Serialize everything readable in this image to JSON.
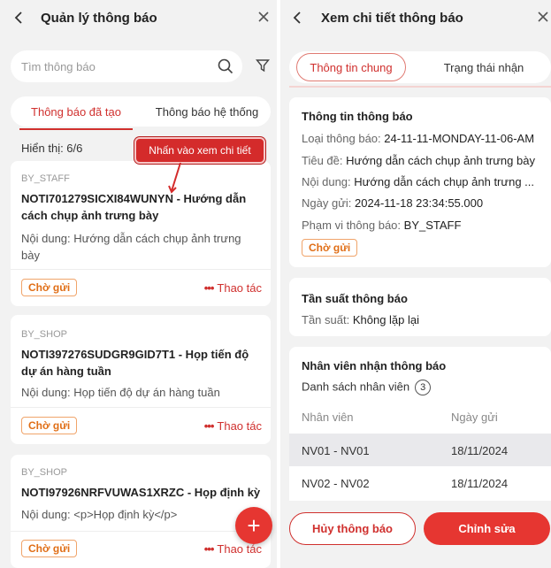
{
  "left": {
    "title": "Quản lý thông báo",
    "search_placeholder": "Tìm thông báo",
    "tabs": [
      {
        "label": "Thông báo đã tạo",
        "active": true
      },
      {
        "label": "Thông báo hệ thống",
        "active": false
      }
    ],
    "count_text": "Hiển thị: 6/6",
    "callout": "Nhấn vào xem chi tiết",
    "cards": [
      {
        "type": "BY_STAFF",
        "title": "NOTI701279SICXI84WUNYN - Hướng dẫn cách chụp ảnh trưng bày",
        "content": "Nội dung: Hướng dẫn cách chụp ảnh trưng bày",
        "status": "Chờ gửi",
        "action": "Thao tác"
      },
      {
        "type": "BY_SHOP",
        "title": "NOTI397276SUDGR9GID7T1 - Họp tiến độ dự án hàng tuần",
        "content": "Nội dung: Họp tiến độ dự án hàng tuần",
        "status": "Chờ gửi",
        "action": "Thao tác"
      },
      {
        "type": "BY_SHOP",
        "title": "NOTI97926NRFVUWAS1XRZC - Họp định kỳ",
        "content": "Nội dung: <p>Họp định kỳ</p>",
        "status": "Chờ gửi",
        "action": "Thao tác"
      }
    ],
    "fab": "+"
  },
  "right": {
    "title": "Xem chi tiết thông báo",
    "tabs": [
      {
        "label": "Thông tin chung",
        "active": true
      },
      {
        "label": "Trạng thái nhận",
        "active": false
      }
    ],
    "info": {
      "heading": "Thông tin thông báo",
      "type_label": "Loại thông báo:",
      "type_value": "24-11-11-MONDAY-11-06-AM",
      "title_label": "Tiêu đề:",
      "title_value": "Hướng dẫn cách chụp ảnh trưng bày",
      "content_label": "Nội dung:",
      "content_value": "Hướng dẫn cách chụp ảnh trưng ...",
      "date_label": "Ngày gửi:",
      "date_value": "2024-11-18 23:34:55.000",
      "scope_label": "Phạm vi thông báo:",
      "scope_value": "BY_STAFF",
      "status": "Chờ gửi"
    },
    "freq": {
      "heading": "Tần suất thông báo",
      "label": "Tần suất:",
      "value": "Không lặp lại"
    },
    "recipients": {
      "heading": "Nhân viên nhận thông báo",
      "list_label": "Danh sách nhân viên",
      "count": "3",
      "col1": "Nhân viên",
      "col2": "Ngày gửi",
      "rows": [
        {
          "emp": "NV01 - NV01",
          "date": "18/11/2024"
        },
        {
          "emp": "NV02 - NV02",
          "date": "18/11/2024"
        }
      ]
    },
    "buttons": {
      "cancel": "Hủy thông báo",
      "edit": "Chỉnh sửa"
    }
  },
  "colors": {
    "accent": "#d0302e",
    "badge": "#e06e16",
    "bg": "#f2f2f2"
  }
}
